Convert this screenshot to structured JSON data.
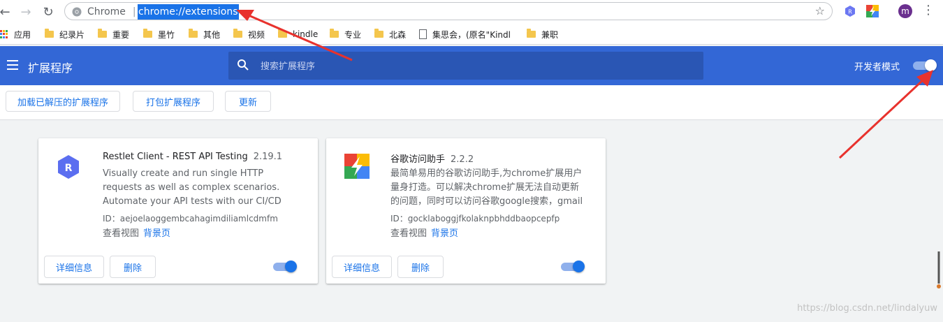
{
  "browser": {
    "site_chip": "Chrome",
    "url": "chrome://extensions",
    "avatar_letter": "m",
    "ext_icon_r": "R"
  },
  "bookmarks": [
    {
      "label": "应用",
      "type": "apps"
    },
    {
      "label": "纪录片",
      "type": "folder"
    },
    {
      "label": "重要",
      "type": "folder"
    },
    {
      "label": "墨竹",
      "type": "folder"
    },
    {
      "label": "其他",
      "type": "folder"
    },
    {
      "label": "视频",
      "type": "folder"
    },
    {
      "label": "kindle",
      "type": "folder"
    },
    {
      "label": "专业",
      "type": "folder"
    },
    {
      "label": "北森",
      "type": "folder"
    },
    {
      "label": "集思会，(原名\"Kindl",
      "type": "page"
    },
    {
      "label": "兼职",
      "type": "folder"
    }
  ],
  "header": {
    "title": "扩展程序",
    "search_placeholder": "搜索扩展程序",
    "dev_mode_label": "开发者模式",
    "dev_mode_on": true
  },
  "actions": {
    "load_unpacked": "加载已解压的扩展程序",
    "pack": "打包扩展程序",
    "update": "更新"
  },
  "extensions": [
    {
      "name": "Restlet Client - REST API Testing",
      "version": "2.19.1",
      "description": "Visually create and run single HTTP requests as well as complex scenarios. Automate your API tests with our CI/CD plugin.",
      "id": "ID：aejoelaoggembcahagimdiliamlcdmfm",
      "views_label": "查看视图",
      "views_link": "背景页",
      "details_label": "详细信息",
      "remove_label": "删除",
      "enabled": true,
      "icon_letter": "R",
      "icon_color": "#5b6ef0"
    },
    {
      "name": "谷歌访问助手",
      "version": "2.2.2",
      "description": "最简单易用的谷歌访问助手,为chrome扩展用户量身打造。可以解决chrome扩展无法自动更新的问题，同时可以访问谷歌google搜索，gmail邮箱，",
      "id": "ID：gocklaboggjfkolaknpbhddbaopcepfp",
      "views_label": "查看视图",
      "views_link": "背景页",
      "details_label": "详细信息",
      "remove_label": "删除",
      "enabled": true
    }
  ],
  "watermark": "https://blog.csdn.net/lindalyuw",
  "colors": {
    "header_blue": "#3367d6",
    "link_blue": "#1a73e8",
    "arrow_red": "#e8322d"
  }
}
